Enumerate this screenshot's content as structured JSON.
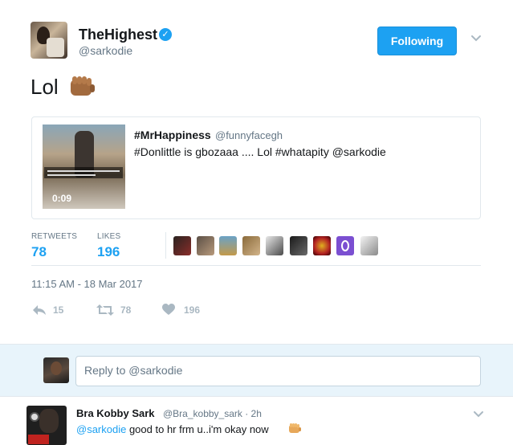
{
  "tweet": {
    "author_name": "TheHighest",
    "author_handle": "@sarkodie",
    "verified_icon": "verified-badge-icon",
    "follow_button_label": "Following",
    "text": "Lol",
    "text_emoji": "fist-bump-emoji",
    "quoted": {
      "author_name": "#MrHappiness",
      "author_handle": "@funnyfacegh",
      "text": "#Donlittle is gbozaaa .... Lol #whatapity @sarkodie",
      "video_duration": "0:09"
    },
    "stats": {
      "retweets_label": "RETWEETS",
      "retweets_count": "78",
      "likes_label": "LIKES",
      "likes_count": "196",
      "liker_avatars": 9
    },
    "timestamp": "11:15 AM - 18 Mar 2017",
    "actions": {
      "reply_count": "15",
      "retweet_count": "78",
      "like_count": "196"
    }
  },
  "reply_box": {
    "placeholder": "Reply to @sarkodie"
  },
  "reply_tweet": {
    "author_name": "Bra Kobby Sark",
    "author_handle": "@Bra_kobby_sark · 2h",
    "mention": "@sarkodie",
    "text": " good to hr frm u..i'm okay now"
  },
  "colors": {
    "accent": "#1da1f2",
    "muted": "#657786",
    "reply_bar_bg": "#e8f4fb"
  }
}
